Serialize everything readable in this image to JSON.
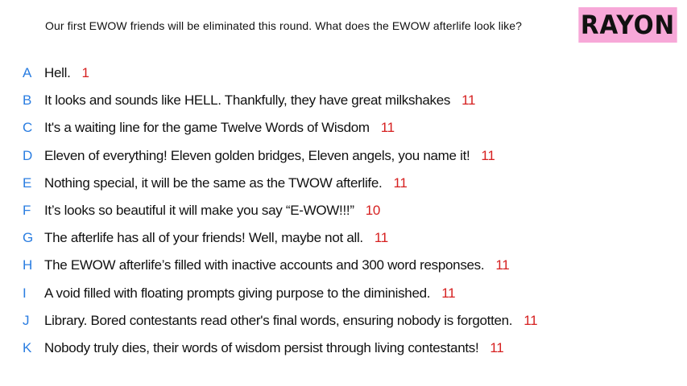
{
  "prompt": "Our first EWOW friends will be eliminated this round. What does the EWOW afterlife look like?",
  "badge": {
    "label": "RAYON",
    "color": "#f7a8d8"
  },
  "colors": {
    "letter": "#2a7de1",
    "count": "#d62020",
    "text": "#111111"
  },
  "responses": [
    {
      "letter": "A",
      "text": "Hell.",
      "count": "1"
    },
    {
      "letter": "B",
      "text": "It looks and sounds like HELL. Thankfully, they have great milkshakes",
      "count": "11"
    },
    {
      "letter": "C",
      "text": "It's a waiting line for the game Twelve Words of Wisdom",
      "count": "11"
    },
    {
      "letter": "D",
      "text": "Eleven of everything! Eleven golden bridges, Eleven angels, you name it!",
      "count": "11"
    },
    {
      "letter": "E",
      "text": "Nothing special, it will be the same as the TWOW afterlife.",
      "count": "11"
    },
    {
      "letter": "F",
      "text": "It’s looks so beautiful it will make you say “E-WOW!!!”",
      "count": "10"
    },
    {
      "letter": "G",
      "text": "The afterlife has all of your friends! Well, maybe not all.",
      "count": "11"
    },
    {
      "letter": "H",
      "text": "The EWOW afterlife’s filled with inactive accounts and 300 word responses.",
      "count": "11"
    },
    {
      "letter": "I",
      "text": "A void filled with floating prompts giving purpose to the diminished.",
      "count": "11"
    },
    {
      "letter": "J",
      "text": "Library. Bored contestants read other's final words, ensuring nobody is forgotten.",
      "count": "11"
    },
    {
      "letter": "K",
      "text": "Nobody truly dies, their words of wisdom persist through living contestants!",
      "count": "11"
    }
  ]
}
